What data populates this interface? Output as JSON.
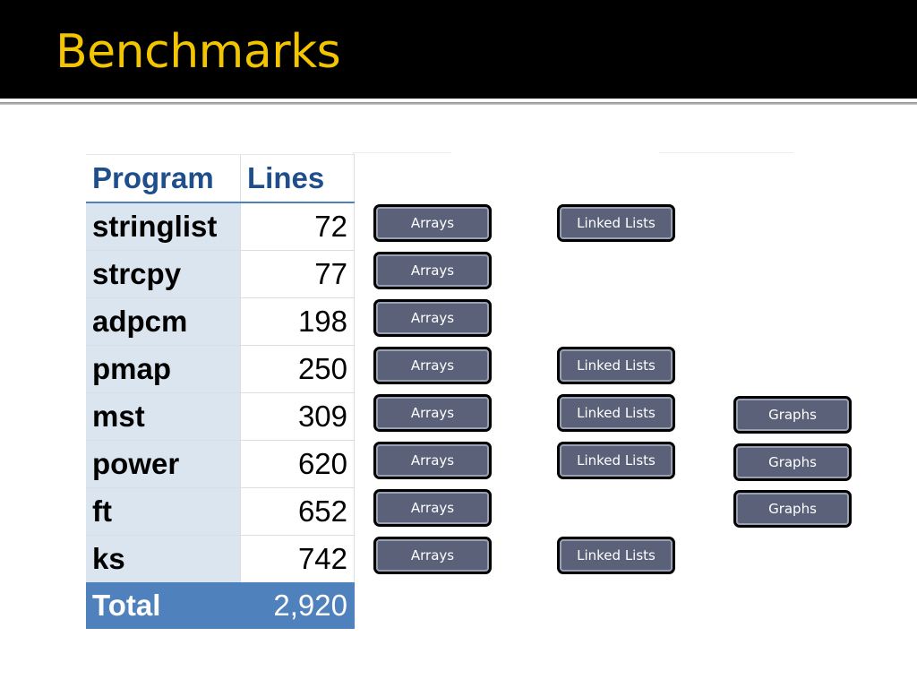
{
  "slide": {
    "title": "Benchmarks"
  },
  "table": {
    "headers": [
      "Program",
      "Lines"
    ],
    "rows": [
      {
        "program": "stringlist",
        "lines": "72"
      },
      {
        "program": "strcpy",
        "lines": "77"
      },
      {
        "program": "adpcm",
        "lines": "198"
      },
      {
        "program": "pmap",
        "lines": "250"
      },
      {
        "program": "mst",
        "lines": "309"
      },
      {
        "program": "power",
        "lines": "620"
      },
      {
        "program": "ft",
        "lines": "652"
      },
      {
        "program": "ks",
        "lines": "742"
      }
    ],
    "total": {
      "label": "Total",
      "lines": "2,920"
    }
  },
  "tags": {
    "arrays": "Arrays",
    "linked_lists": "Linked Lists",
    "graphs": "Graphs",
    "per_row": [
      {
        "program": "stringlist",
        "arrays": true,
        "linked_lists": true,
        "graphs": false
      },
      {
        "program": "strcpy",
        "arrays": true,
        "linked_lists": false,
        "graphs": false
      },
      {
        "program": "adpcm",
        "arrays": true,
        "linked_lists": false,
        "graphs": false
      },
      {
        "program": "pmap",
        "arrays": true,
        "linked_lists": true,
        "graphs": false
      },
      {
        "program": "mst",
        "arrays": true,
        "linked_lists": true,
        "graphs": true
      },
      {
        "program": "power",
        "arrays": true,
        "linked_lists": true,
        "graphs": true
      },
      {
        "program": "ft",
        "arrays": true,
        "linked_lists": false,
        "graphs": true
      },
      {
        "program": "ks",
        "arrays": true,
        "linked_lists": true,
        "graphs": false
      }
    ]
  },
  "colors": {
    "title": "#f2c500",
    "title_bar": "#000000",
    "header_text": "#1f4e8c",
    "first_col_fill": "#dbe5f0",
    "total_fill": "#4f81bd",
    "tag_fill": "#5a6178"
  }
}
